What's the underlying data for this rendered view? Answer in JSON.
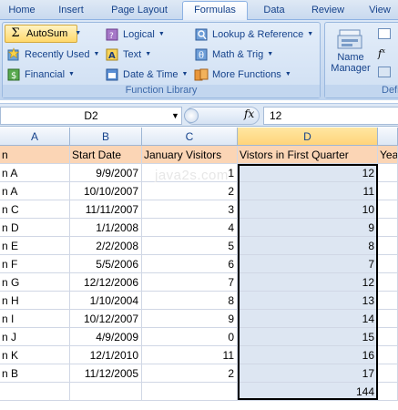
{
  "tabs": [
    "Home",
    "Insert",
    "Page Layout",
    "Formulas",
    "Data",
    "Review",
    "View"
  ],
  "ribbon": {
    "autosum": "AutoSum",
    "recently_used": "Recently Used",
    "financial": "Financial",
    "logical": "Logical",
    "text": "Text",
    "date_time": "Date & Time",
    "lookup_reference": "Lookup & Reference",
    "math_trig": "Math & Trig",
    "more_functions": "More Functions",
    "function_library": "Function Library",
    "name_manager_line1": "Name",
    "name_manager_line2": "Manager",
    "defined_names_partial": "Defi"
  },
  "formula_bar": {
    "name_box": "D2",
    "fx": "fx",
    "formula": "12"
  },
  "columns": [
    "A",
    "B",
    "C",
    "D",
    "Ye"
  ],
  "header_row": {
    "a": "n",
    "b": "Start Date",
    "c": "January Visitors",
    "d": "Vistors in First Quarter",
    "e": "Yea"
  },
  "rows": [
    {
      "a": "n A",
      "b": "9/9/2007",
      "c": "1",
      "d": "12"
    },
    {
      "a": "n A",
      "b": "10/10/2007",
      "c": "2",
      "d": "11"
    },
    {
      "a": "n C",
      "b": "11/11/2007",
      "c": "3",
      "d": "10"
    },
    {
      "a": "n D",
      "b": "1/1/2008",
      "c": "4",
      "d": "9"
    },
    {
      "a": "n E",
      "b": "2/2/2008",
      "c": "5",
      "d": "8"
    },
    {
      "a": "n F",
      "b": "5/5/2006",
      "c": "6",
      "d": "7"
    },
    {
      "a": "n G",
      "b": "12/12/2006",
      "c": "7",
      "d": "12"
    },
    {
      "a": "n H",
      "b": "1/10/2004",
      "c": "8",
      "d": "13"
    },
    {
      "a": "n I",
      "b": "10/12/2007",
      "c": "9",
      "d": "14"
    },
    {
      "a": "n J",
      "b": "4/9/2009",
      "c": "0",
      "d": "15"
    },
    {
      "a": "n K",
      "b": "12/1/2010",
      "c": "11",
      "d": "16"
    },
    {
      "a": "n B",
      "b": "11/12/2005",
      "c": "2",
      "d": "17"
    }
  ],
  "total": "144",
  "watermark": "java2s.com"
}
